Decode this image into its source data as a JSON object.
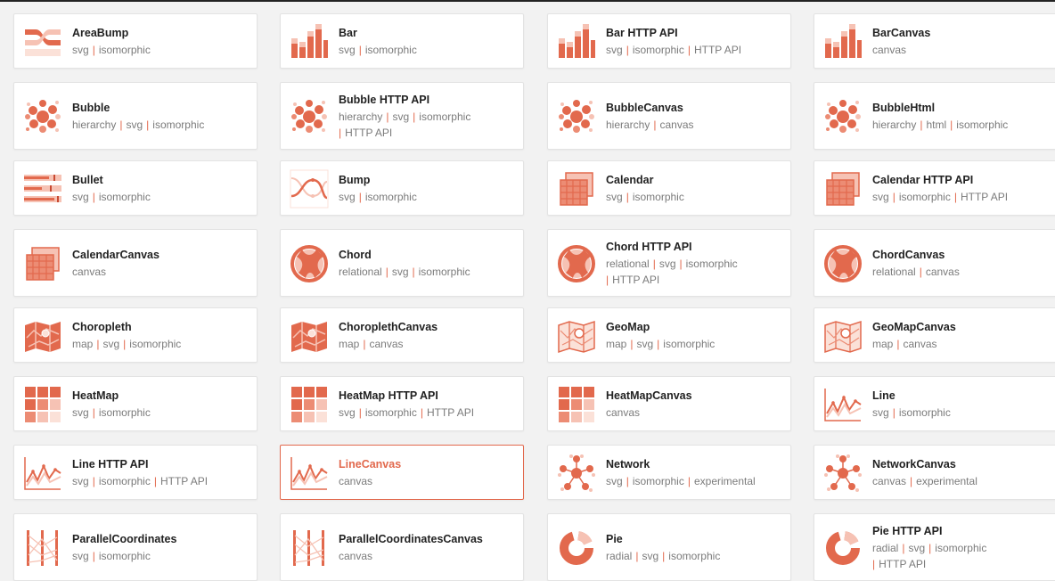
{
  "accent": "#e2694d",
  "cards": [
    {
      "title": "AreaBump",
      "icon": "area-bump",
      "tags": [
        "svg",
        "isomorphic"
      ]
    },
    {
      "title": "Bar",
      "icon": "bar",
      "tags": [
        "svg",
        "isomorphic"
      ]
    },
    {
      "title": "Bar HTTP API",
      "icon": "bar",
      "tags": [
        "svg",
        "isomorphic",
        "HTTP API"
      ]
    },
    {
      "title": "BarCanvas",
      "icon": "bar",
      "tags": [
        "canvas"
      ]
    },
    {
      "title": "Bubble",
      "icon": "bubble",
      "tags": [
        "hierarchy",
        "svg",
        "isomorphic"
      ]
    },
    {
      "title": "Bubble HTTP API",
      "icon": "bubble",
      "tags": [
        "hierarchy",
        "svg",
        "isomorphic"
      ],
      "tags2": [
        "HTTP API"
      ]
    },
    {
      "title": "BubbleCanvas",
      "icon": "bubble",
      "tags": [
        "hierarchy",
        "canvas"
      ]
    },
    {
      "title": "BubbleHtml",
      "icon": "bubble",
      "tags": [
        "hierarchy",
        "html",
        "isomorphic"
      ]
    },
    {
      "title": "Bullet",
      "icon": "bullet",
      "tags": [
        "svg",
        "isomorphic"
      ]
    },
    {
      "title": "Bump",
      "icon": "bump",
      "tags": [
        "svg",
        "isomorphic"
      ]
    },
    {
      "title": "Calendar",
      "icon": "calendar",
      "tags": [
        "svg",
        "isomorphic"
      ]
    },
    {
      "title": "Calendar HTTP API",
      "icon": "calendar",
      "tags": [
        "svg",
        "isomorphic",
        "HTTP API"
      ]
    },
    {
      "title": "CalendarCanvas",
      "icon": "calendar",
      "tags": [
        "canvas"
      ]
    },
    {
      "title": "Chord",
      "icon": "chord",
      "tags": [
        "relational",
        "svg",
        "isomorphic"
      ]
    },
    {
      "title": "Chord HTTP API",
      "icon": "chord",
      "tags": [
        "relational",
        "svg",
        "isomorphic"
      ],
      "tags2": [
        "HTTP API"
      ]
    },
    {
      "title": "ChordCanvas",
      "icon": "chord",
      "tags": [
        "relational",
        "canvas"
      ]
    },
    {
      "title": "Choropleth",
      "icon": "choropleth",
      "tags": [
        "map",
        "svg",
        "isomorphic"
      ]
    },
    {
      "title": "ChoroplethCanvas",
      "icon": "choropleth",
      "tags": [
        "map",
        "canvas"
      ]
    },
    {
      "title": "GeoMap",
      "icon": "geomap",
      "tags": [
        "map",
        "svg",
        "isomorphic"
      ]
    },
    {
      "title": "GeoMapCanvas",
      "icon": "geomap",
      "tags": [
        "map",
        "canvas"
      ]
    },
    {
      "title": "HeatMap",
      "icon": "heatmap",
      "tags": [
        "svg",
        "isomorphic"
      ]
    },
    {
      "title": "HeatMap HTTP API",
      "icon": "heatmap",
      "tags": [
        "svg",
        "isomorphic",
        "HTTP API"
      ]
    },
    {
      "title": "HeatMapCanvas",
      "icon": "heatmap",
      "tags": [
        "canvas"
      ]
    },
    {
      "title": "Line",
      "icon": "line",
      "tags": [
        "svg",
        "isomorphic"
      ]
    },
    {
      "title": "Line HTTP API",
      "icon": "line",
      "tags": [
        "svg",
        "isomorphic",
        "HTTP API"
      ]
    },
    {
      "title": "LineCanvas",
      "icon": "line",
      "tags": [
        "canvas"
      ],
      "active": true
    },
    {
      "title": "Network",
      "icon": "network",
      "tags": [
        "svg",
        "isomorphic",
        "experimental"
      ]
    },
    {
      "title": "NetworkCanvas",
      "icon": "network",
      "tags": [
        "canvas",
        "experimental"
      ]
    },
    {
      "title": "ParallelCoordinates",
      "icon": "parallel",
      "tags": [
        "svg",
        "isomorphic"
      ]
    },
    {
      "title": "ParallelCoordinatesCanvas",
      "icon": "parallel",
      "tags": [
        "canvas"
      ]
    },
    {
      "title": "Pie",
      "icon": "pie",
      "tags": [
        "radial",
        "svg",
        "isomorphic"
      ]
    },
    {
      "title": "Pie HTTP API",
      "icon": "pie",
      "tags": [
        "radial",
        "svg",
        "isomorphic"
      ],
      "tags2": [
        "HTTP API"
      ]
    }
  ]
}
